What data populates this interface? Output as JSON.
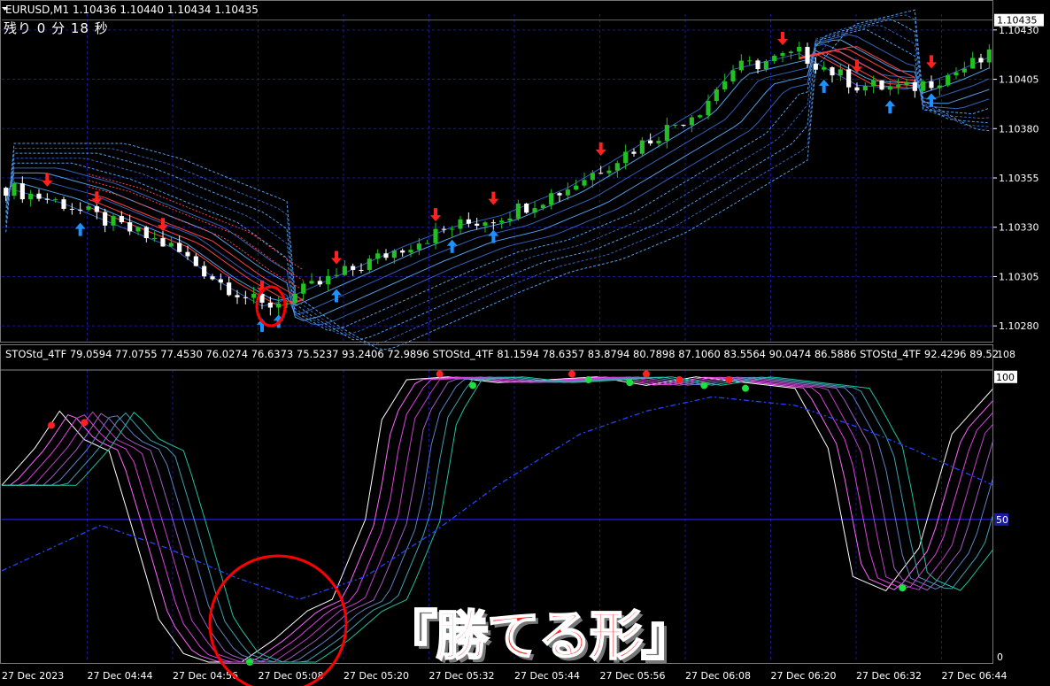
{
  "window": {
    "symbol_line": "EURUSD,M1  1.10436 1.10440 1.10434 1.10435",
    "countdown": "残り 0 分 18 秒"
  },
  "caption": "『勝てる形』",
  "colors": {
    "background": "#000000",
    "grid": "#1a1a8c",
    "bull": "#22c022",
    "bear": "#ffffff",
    "buy_arrow": "#1e90ff",
    "sell_arrow": "#ff2020",
    "ribbon_up": "#5ab0ff",
    "ribbon_down": "#ff4040",
    "sto_fast": "#ffffff",
    "sto_mid": "#e040e0",
    "sto_slow": "#20c0a0",
    "sto_long": "#2244ff",
    "highlight_circle": "#ff0000"
  },
  "chart_data": [
    {
      "type": "candlestick",
      "symbol": "EURUSD",
      "timeframe": "M1",
      "y_ticks": [
        "1.10430",
        "1.10405",
        "1.10380",
        "1.10355",
        "1.10330",
        "1.10305",
        "1.10280"
      ],
      "current_price": "1.10435",
      "ylim": [
        1.10272,
        1.10438
      ],
      "trend_path": [
        [
          0,
          1.1035
        ],
        [
          7,
          1.10342
        ],
        [
          14,
          1.1033
        ],
        [
          20,
          1.1032
        ],
        [
          26,
          1.10302
        ],
        [
          31,
          1.1029
        ],
        [
          33,
          1.10292
        ],
        [
          40,
          1.10305
        ],
        [
          48,
          1.1032
        ],
        [
          54,
          1.1033
        ],
        [
          60,
          1.10336
        ],
        [
          68,
          1.1035
        ],
        [
          76,
          1.1037
        ],
        [
          84,
          1.1039
        ],
        [
          88,
          1.1041
        ],
        [
          96,
          1.10418
        ],
        [
          103,
          1.10402
        ],
        [
          109,
          1.104
        ],
        [
          114,
          1.10407
        ],
        [
          120,
          1.10418
        ]
      ],
      "buy_arrows": [
        9,
        31,
        33,
        40,
        54,
        59,
        99,
        107,
        112
      ],
      "sell_arrows": [
        5,
        11,
        19,
        31,
        40,
        52,
        59,
        72,
        94,
        103,
        112
      ],
      "annotation": "circle around buy arrow at 27 Dec 05:08"
    },
    {
      "type": "line",
      "indicator": "STOStd_4TF",
      "header": "STOStd_4TF 79.0594 77.0755 77.4530 76.0274 76.6373 75.5237 93.2406 72.9896   STOStd_4TF 81.1594 78.6357 83.8794 80.7898 87.1060 83.5564 90.0474 86.5886   STOStd_4TF 92.4296 89.52",
      "y_ticks": [
        "108",
        "100",
        "50",
        "0"
      ],
      "ylim": [
        0,
        108
      ],
      "level_line": 50,
      "fast_path": [
        [
          0,
          62
        ],
        [
          4,
          75
        ],
        [
          7,
          88
        ],
        [
          10,
          78
        ],
        [
          13,
          74
        ],
        [
          16,
          45
        ],
        [
          19,
          15
        ],
        [
          22,
          3
        ],
        [
          25,
          0
        ],
        [
          29,
          0
        ],
        [
          33,
          8
        ],
        [
          37,
          18
        ],
        [
          40,
          22
        ],
        [
          44,
          50
        ],
        [
          46,
          85
        ],
        [
          49,
          99
        ],
        [
          54,
          100
        ],
        [
          60,
          98
        ],
        [
          66,
          99
        ],
        [
          72,
          100
        ],
        [
          78,
          97
        ],
        [
          84,
          100
        ],
        [
          90,
          98
        ],
        [
          96,
          96
        ],
        [
          100,
          75
        ],
        [
          103,
          30
        ],
        [
          107,
          25
        ],
        [
          111,
          40
        ],
        [
          115,
          80
        ],
        [
          120,
          96
        ]
      ],
      "long_path": [
        [
          0,
          32
        ],
        [
          6,
          40
        ],
        [
          12,
          48
        ],
        [
          20,
          40
        ],
        [
          28,
          30
        ],
        [
          36,
          22
        ],
        [
          44,
          30
        ],
        [
          52,
          45
        ],
        [
          60,
          62
        ],
        [
          70,
          80
        ],
        [
          78,
          88
        ],
        [
          86,
          93
        ],
        [
          96,
          90
        ],
        [
          104,
          82
        ],
        [
          110,
          75
        ],
        [
          120,
          62
        ]
      ],
      "red_dots": [
        [
          6,
          83
        ],
        [
          10,
          84
        ],
        [
          53,
          101
        ],
        [
          69,
          101
        ],
        [
          78,
          101
        ],
        [
          82,
          99
        ],
        [
          88,
          99
        ]
      ],
      "green_dots": [
        [
          30,
          0
        ],
        [
          57,
          97
        ],
        [
          71,
          99
        ],
        [
          76,
          98
        ],
        [
          85,
          97
        ],
        [
          90,
          96
        ],
        [
          109,
          26
        ]
      ],
      "annotation": "circle around stochastic bottom at 27 Dec 05:08"
    }
  ],
  "x_axis": {
    "labels": [
      "27 Dec 2023",
      "27 Dec 04:44",
      "27 Dec 04:56",
      "27 Dec 05:08",
      "27 Dec 05:20",
      "27 Dec 05:32",
      "27 Dec 05:44",
      "27 Dec 05:56",
      "27 Dec 06:08",
      "27 Dec 06:20",
      "27 Dec 06:32",
      "27 Dec 06:44"
    ]
  }
}
